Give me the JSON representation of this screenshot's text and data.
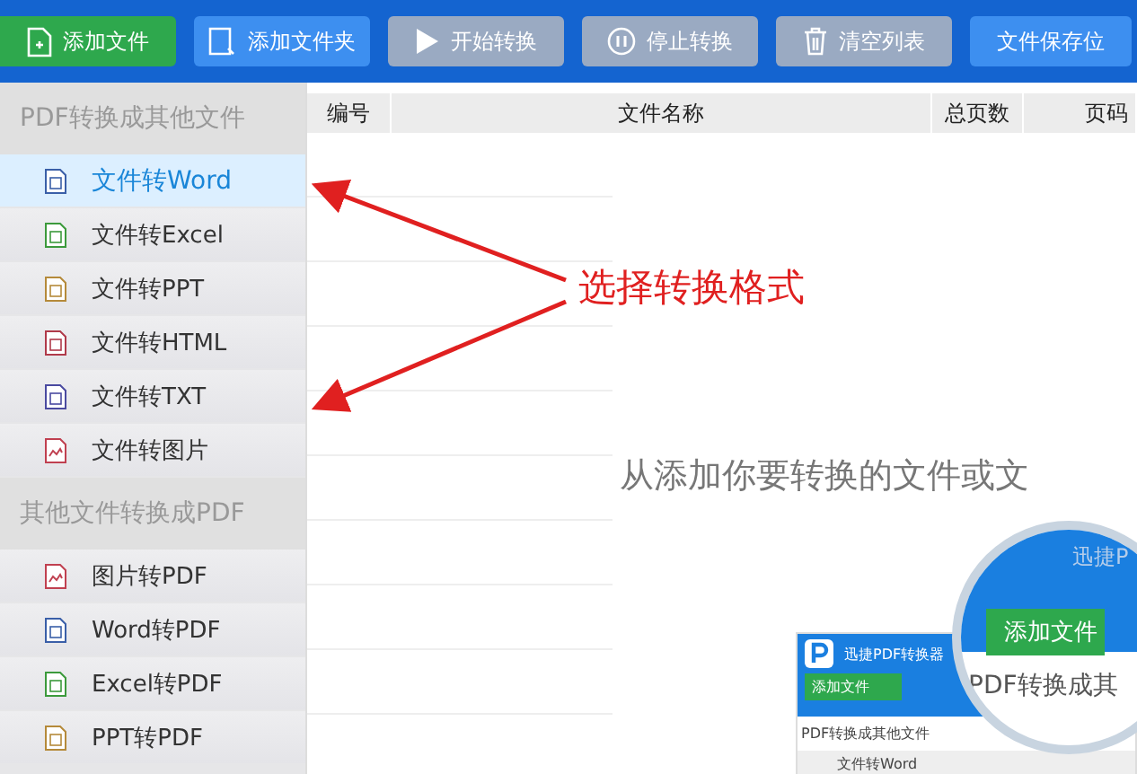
{
  "toolbar": {
    "buttons": [
      {
        "label": "添加文件",
        "kind": "add",
        "disabled": false
      },
      {
        "label": "添加文件夹",
        "kind": "folder",
        "disabled": false
      },
      {
        "label": "开始转换",
        "kind": "start",
        "disabled": true
      },
      {
        "label": "停止转换",
        "kind": "stop",
        "disabled": true
      },
      {
        "label": "清空列表",
        "kind": "clear",
        "disabled": true
      },
      {
        "label": "文件保存位",
        "kind": "save",
        "disabled": false
      }
    ]
  },
  "sidebar": {
    "sections": [
      {
        "title": "PDF转换成其他文件",
        "items": [
          {
            "label": "文件转Word",
            "kind": "word",
            "selected": true
          },
          {
            "label": "文件转Excel",
            "kind": "excel",
            "selected": false
          },
          {
            "label": "文件转PPT",
            "kind": "ppt",
            "selected": false
          },
          {
            "label": "文件转HTML",
            "kind": "html",
            "selected": false
          },
          {
            "label": "文件转TXT",
            "kind": "txt",
            "selected": false
          },
          {
            "label": "文件转图片",
            "kind": "image",
            "selected": false
          }
        ]
      },
      {
        "title": "其他文件转换成PDF",
        "items": [
          {
            "label": "图片转PDF",
            "kind": "image",
            "selected": false
          },
          {
            "label": "Word转PDF",
            "kind": "word",
            "selected": false
          },
          {
            "label": "Excel转PDF",
            "kind": "excel",
            "selected": false
          },
          {
            "label": "PPT转PDF",
            "kind": "ppt",
            "selected": false
          }
        ]
      }
    ]
  },
  "table": {
    "columns": [
      "编号",
      "文件名称",
      "总页数",
      "页码"
    ],
    "empty_hint": "从添加你要转换的文件或文"
  },
  "annotation": {
    "text": "选择转换格式"
  },
  "inset": {
    "title": "迅捷PDF转换器",
    "button": "添加文件",
    "section": "PDF转换成其他文件",
    "item": "文件转Word",
    "magnifier": {
      "title": "迅捷P",
      "button": "添加文件",
      "section": "PDF转换成其"
    }
  }
}
